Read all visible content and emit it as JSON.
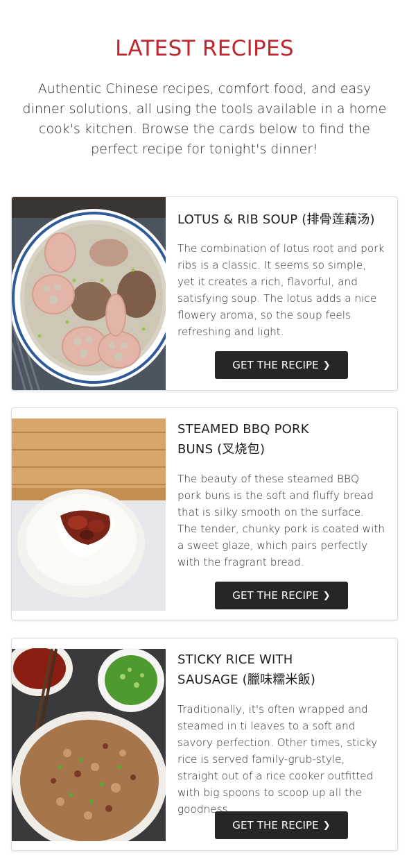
{
  "header": {
    "title": "LATEST RECIPES",
    "intro": "Authentic Chinese recipes, comfort food, and easy dinner solutions, all using the tools available in a home cook's kitchen. Browse the cards below to find the perfect recipe for tonight's dinner!"
  },
  "cards": [
    {
      "title": "LOTUS & RIB SOUP (排骨莲藕汤)",
      "description": "The combination of lotus root and pork ribs is a classic. It seems so simple, yet it creates a rich, flavorful, and satisfying soup. The lotus adds a nice flowery aroma, so the soup feels refreshing and light.",
      "button_label": "GET THE RECIPE",
      "button_icon": "chevron-right-icon",
      "image_subject": "lotus-rib-soup-photo"
    },
    {
      "title": "STEAMED BBQ PORK BUNS (叉烧包)",
      "description": "The beauty of these steamed BBQ pork buns is the soft and fluffy bread that is silky smooth on the surface. The tender, chunky pork is coated with a sweet glaze, which pairs perfectly with the fragrant bread.",
      "button_label": "GET THE RECIPE",
      "button_icon": "chevron-right-icon",
      "image_subject": "bbq-pork-bun-photo"
    },
    {
      "title": "STICKY RICE WITH SAUSAGE (臘味糯米飯)",
      "description": "Traditionally, it's often wrapped and steamed in ti leaves to a soft and savory perfection. Other times, sticky rice is served family-grub-style, straight out of a rice cooker outfitted with big spoons to scoop up all the goodness.",
      "button_label": "GET THE RECIPE",
      "button_icon": "chevron-right-icon",
      "image_subject": "sticky-rice-sausage-photo"
    }
  ],
  "colors": {
    "title_red": "#c0262e",
    "button_bg": "#262626",
    "button_text": "#ffffff",
    "card_border": "#dcdcdc"
  }
}
